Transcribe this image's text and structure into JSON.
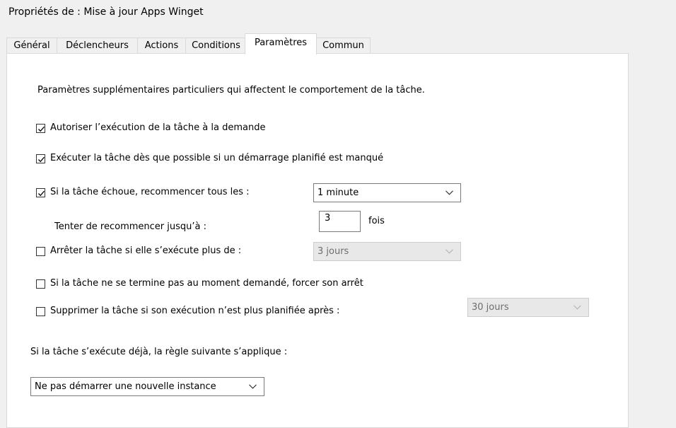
{
  "window": {
    "title": "Propriétés de : Mise à jour Apps Winget"
  },
  "tabs": [
    {
      "label": "Général"
    },
    {
      "label": "Déclencheurs"
    },
    {
      "label": "Actions"
    },
    {
      "label": "Conditions"
    },
    {
      "label": "Paramètres",
      "active": true
    },
    {
      "label": "Commun"
    }
  ],
  "settings": {
    "intro": "Paramètres supplémentaires particuliers qui affectent le comportement de la tâche.",
    "allow_on_demand": {
      "label": "Autoriser l’exécution de la tâche à la demande",
      "checked": true
    },
    "run_asap_missed": {
      "label": "Exécuter la tâche dès que possible si un démarrage planifié est manqué",
      "checked": true
    },
    "restart_on_fail": {
      "label": "Si la tâche échoue, recommencer tous les :",
      "checked": true,
      "interval": "1 minute"
    },
    "retry": {
      "label": "Tenter de recommencer jusqu’à :",
      "count": "3",
      "unit": "fois"
    },
    "stop_if_longer": {
      "label": "Arrêter la tâche si elle s’exécute plus de :",
      "checked": false,
      "value": "3 jours"
    },
    "force_stop": {
      "label": "Si la tâche ne se termine pas au moment demandé, forcer son arrêt",
      "checked": false
    },
    "delete_if_not_scheduled": {
      "label": "Supprimer la tâche si son exécution n’est plus planifiée après :",
      "checked": false,
      "value": "30 jours"
    },
    "rule_label": "Si la tâche s’exécute déjà, la règle suivante s’applique :",
    "rule_value": "Ne pas démarrer une nouvelle instance"
  },
  "colors": {
    "check": "#000000",
    "disabled_bg": "#e8e8e8",
    "border": "#7a7a7a"
  }
}
